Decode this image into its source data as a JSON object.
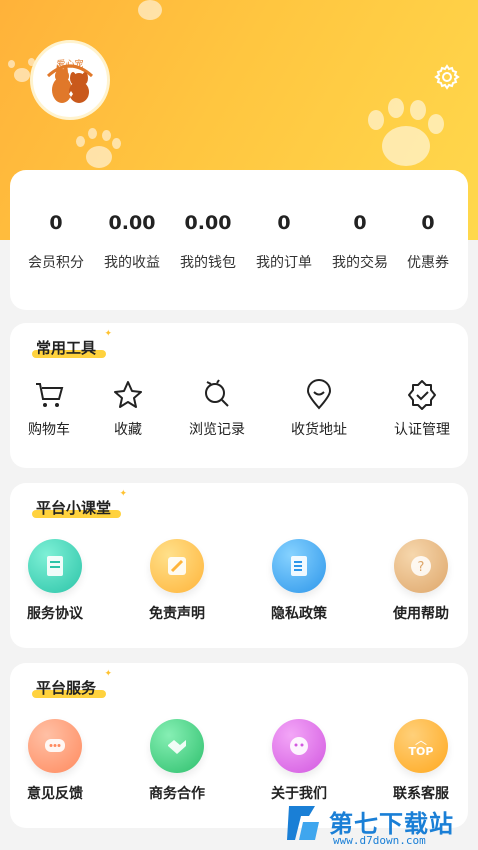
{
  "profile": {
    "avatar_text": "爱心宠",
    "settings_icon": "gear-icon"
  },
  "stats": [
    {
      "value": "0",
      "label": "会员积分"
    },
    {
      "value": "0.00",
      "label": "我的收益"
    },
    {
      "value": "0.00",
      "label": "我的钱包"
    },
    {
      "value": "0",
      "label": "我的订单"
    },
    {
      "value": "0",
      "label": "我的交易"
    },
    {
      "value": "0",
      "label": "优惠券"
    }
  ],
  "tools": {
    "title": "常用工具",
    "items": [
      {
        "label": "购物车",
        "icon": "cart-icon"
      },
      {
        "label": "收藏",
        "icon": "star-icon"
      },
      {
        "label": "浏览记录",
        "icon": "footprint-icon"
      },
      {
        "label": "收货地址",
        "icon": "location-icon"
      },
      {
        "label": "认证管理",
        "icon": "badge-check-icon"
      }
    ]
  },
  "classroom": {
    "title": "平台小课堂",
    "items": [
      {
        "label": "服务协议",
        "icon": "document-icon",
        "color": "#3fd1b4"
      },
      {
        "label": "免责声明",
        "icon": "disclaimer-icon",
        "color": "#ffc04a"
      },
      {
        "label": "隐私政策",
        "icon": "privacy-icon",
        "color": "#3aa6f2"
      },
      {
        "label": "使用帮助",
        "icon": "help-icon",
        "color": "#e7b47a"
      }
    ]
  },
  "services": {
    "title": "平台服务",
    "items": [
      {
        "label": "意见反馈",
        "icon": "feedback-icon",
        "color": "#ff9a73"
      },
      {
        "label": "商务合作",
        "icon": "handshake-icon",
        "color": "#3fcc7e"
      },
      {
        "label": "关于我们",
        "icon": "about-icon",
        "color": "#e06fe8"
      },
      {
        "label": "联系客服",
        "icon": "support-icon",
        "color": "#ffb127"
      }
    ]
  },
  "top_button": "TOP",
  "watermark": {
    "title": "第七下载站",
    "url": "www.d7down.com"
  }
}
